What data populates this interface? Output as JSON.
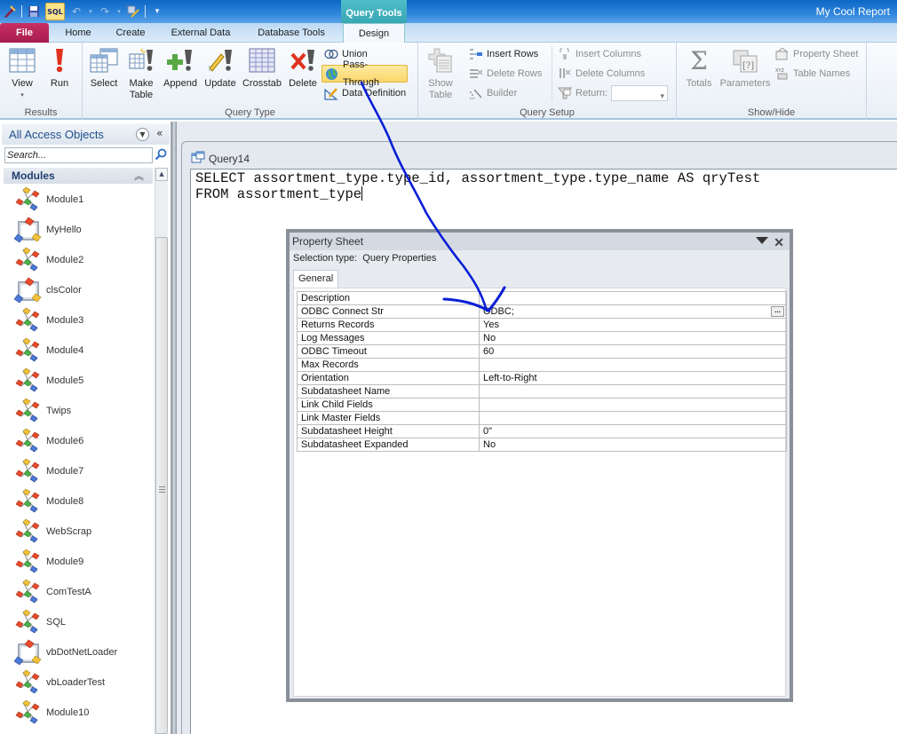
{
  "app": {
    "title": "My Cool Report",
    "context_tab_group": "Query Tools"
  },
  "quick_access": {
    "sql_label": "SQL",
    "items": [
      "access-icon",
      "save-icon",
      "sql-view-icon",
      "undo-icon",
      "redo-icon",
      "wizard-icon",
      "customize-icon"
    ]
  },
  "tabs": [
    {
      "label": "File"
    },
    {
      "label": "Home"
    },
    {
      "label": "Create"
    },
    {
      "label": "External Data"
    },
    {
      "label": "Database Tools"
    },
    {
      "label": "Design",
      "active": true
    }
  ],
  "ribbon": {
    "results": {
      "label": "Results",
      "view": "View",
      "run": "Run"
    },
    "query_type": {
      "label": "Query Type",
      "select": "Select",
      "make_table_1": "Make",
      "make_table_2": "Table",
      "append": "Append",
      "update": "Update",
      "crosstab": "Crosstab",
      "delete": "Delete",
      "union": "Union",
      "pass_through": "Pass-Through",
      "data_definition": "Data Definition"
    },
    "query_setup": {
      "label": "Query Setup",
      "show_table_1": "Show",
      "show_table_2": "Table",
      "insert_rows": "Insert Rows",
      "delete_rows": "Delete Rows",
      "builder": "Builder",
      "insert_columns": "Insert Columns",
      "delete_columns": "Delete Columns",
      "return": "Return:",
      "return_value": ""
    },
    "show_hide": {
      "label": "Show/Hide",
      "totals": "Totals",
      "parameters": "Parameters",
      "property_sheet": "Property Sheet",
      "table_names": "Table Names"
    }
  },
  "nav": {
    "title": "All Access Objects",
    "search_placeholder": "Search...",
    "section": "Modules",
    "items": [
      {
        "label": "Module1",
        "kind": "module"
      },
      {
        "label": "MyHello",
        "kind": "class"
      },
      {
        "label": "Module2",
        "kind": "module"
      },
      {
        "label": "clsColor",
        "kind": "class"
      },
      {
        "label": "Module3",
        "kind": "module"
      },
      {
        "label": "Module4",
        "kind": "module"
      },
      {
        "label": "Module5",
        "kind": "module"
      },
      {
        "label": "Twips",
        "kind": "module"
      },
      {
        "label": "Module6",
        "kind": "module"
      },
      {
        "label": "Module7",
        "kind": "module"
      },
      {
        "label": "Module8",
        "kind": "module"
      },
      {
        "label": "WebScrap",
        "kind": "module"
      },
      {
        "label": "Module9",
        "kind": "module"
      },
      {
        "label": "ComTestA",
        "kind": "module"
      },
      {
        "label": "SQL",
        "kind": "module"
      },
      {
        "label": "vbDotNetLoader",
        "kind": "class"
      },
      {
        "label": "vbLoaderTest",
        "kind": "module"
      },
      {
        "label": "Module10",
        "kind": "module"
      }
    ]
  },
  "document": {
    "tab_label": "Query14",
    "sql_lines": [
      "SELECT assortment_type.type_id, assortment_type.type_name AS qryTest",
      "FROM assortment_type"
    ]
  },
  "property_sheet": {
    "title": "Property Sheet",
    "selection_type_label": "Selection type:",
    "selection_type_value": "Query Properties",
    "tab": "General",
    "rows": [
      {
        "key": "Description",
        "value": ""
      },
      {
        "key": "ODBC Connect Str",
        "value": "ODBC;",
        "has_builder": true
      },
      {
        "key": "Returns Records",
        "value": "Yes"
      },
      {
        "key": "Log Messages",
        "value": "No"
      },
      {
        "key": "ODBC Timeout",
        "value": "60"
      },
      {
        "key": "Max Records",
        "value": ""
      },
      {
        "key": "Orientation",
        "value": "Left-to-Right"
      },
      {
        "key": "Subdatasheet Name",
        "value": ""
      },
      {
        "key": "Link Child Fields",
        "value": ""
      },
      {
        "key": "Link Master Fields",
        "value": ""
      },
      {
        "key": "Subdatasheet Height",
        "value": "0\""
      },
      {
        "key": "Subdatasheet Expanded",
        "value": "No"
      }
    ],
    "builder_label": "..."
  },
  "colors": {
    "annotation": "#0a1fd6",
    "file_tab": "#b8235a",
    "context_tab": "#42b1bd",
    "active_button": "#fbd86a"
  }
}
